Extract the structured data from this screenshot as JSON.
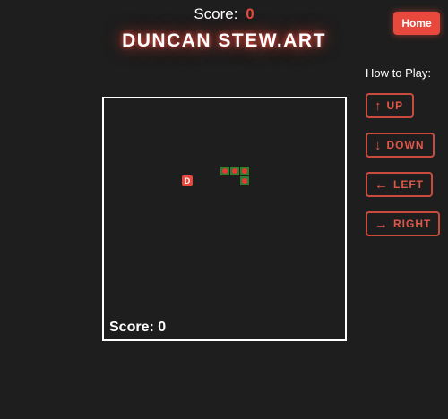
{
  "header": {
    "score_label": "Score:",
    "score_value": "0",
    "brand": "DUNCAN STEW.ART",
    "home_label": "Home"
  },
  "controls": {
    "title": "How to Play:",
    "up": {
      "arrow": "↑",
      "label": "UP"
    },
    "down": {
      "arrow": "↓",
      "label": "DOWN"
    },
    "left": {
      "arrow": "←",
      "label": "LEFT"
    },
    "right": {
      "arrow": "→",
      "label": "RIGHT"
    }
  },
  "board": {
    "score_text": "Score: 0",
    "food_letter": "D",
    "snake_segments": 4
  },
  "colors": {
    "accent": "#e8493c",
    "background": "#1e1e1e",
    "snake_body": "#2e7d32",
    "snake_dot": "#e53935"
  }
}
